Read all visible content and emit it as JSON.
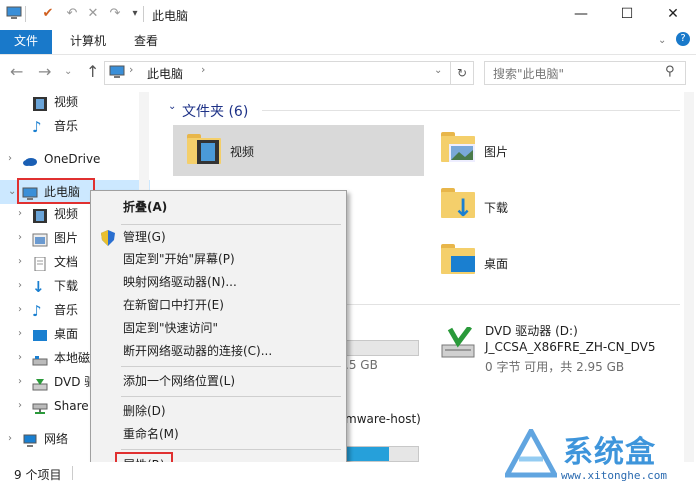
{
  "window": {
    "title": "此电脑"
  },
  "ribbon": {
    "tabs": [
      "文件",
      "计算机",
      "查看"
    ]
  },
  "address": {
    "path_label": "此电脑",
    "search_placeholder": "搜索\"此电脑\""
  },
  "nav_pane": {
    "items": [
      {
        "label": "视频",
        "icon": "video-icon"
      },
      {
        "label": "音乐",
        "icon": "music-icon"
      },
      {
        "label": "OneDrive",
        "icon": "cloud-icon"
      },
      {
        "label": "此电脑",
        "icon": "computer-icon"
      },
      {
        "label": "视频",
        "icon": "video-icon"
      },
      {
        "label": "图片",
        "icon": "picture-icon"
      },
      {
        "label": "文档",
        "icon": "document-icon"
      },
      {
        "label": "下载",
        "icon": "download-icon"
      },
      {
        "label": "音乐",
        "icon": "music-icon"
      },
      {
        "label": "桌面",
        "icon": "desktop-icon"
      },
      {
        "label": "本地磁",
        "icon": "drive-icon"
      },
      {
        "label": "DVD 驱",
        "icon": "dvd-icon"
      },
      {
        "label": "Share",
        "icon": "network-drive-icon"
      },
      {
        "label": "网络",
        "icon": "network-icon"
      }
    ]
  },
  "content": {
    "folders_header": "文件夹 (6)",
    "folders": [
      {
        "label": "视频",
        "icon": "video-folder-icon"
      },
      {
        "label": "图片",
        "icon": "picture-folder-icon"
      },
      {
        "label": "下载",
        "icon": "download-folder-icon"
      },
      {
        "label": "桌面",
        "icon": "desktop-folder-icon"
      }
    ],
    "dvd": {
      "name": "DVD 驱动器 (D:)",
      "volume": "J_CCSA_X86FRE_ZH-CN_DV5",
      "space": "0 字节 可用，共 2.95 GB",
      "used_fraction": 1.0
    },
    "local_disk": {
      "space_fragment": ".5 GB",
      "used_fraction": 0.0
    },
    "share": {
      "name_fragment": "mware-host)",
      "used_fraction": 0.6
    }
  },
  "context_menu": {
    "items": [
      "折叠(A)",
      "管理(G)",
      "固定到\"开始\"屏幕(P)",
      "映射网络驱动器(N)...",
      "在新窗口中打开(E)",
      "固定到\"快速访问\"",
      "断开网络驱动器的连接(C)...",
      "添加一个网络位置(L)",
      "删除(D)",
      "重命名(M)",
      "属性(R)"
    ]
  },
  "status": {
    "count": "9 个项目"
  },
  "watermark": {
    "brand": "系统盒",
    "url": "www.xitonghe.com"
  },
  "colors": {
    "accent": "#1979ca",
    "highlight_box": "#e03030",
    "selection": "#cce8ff"
  }
}
